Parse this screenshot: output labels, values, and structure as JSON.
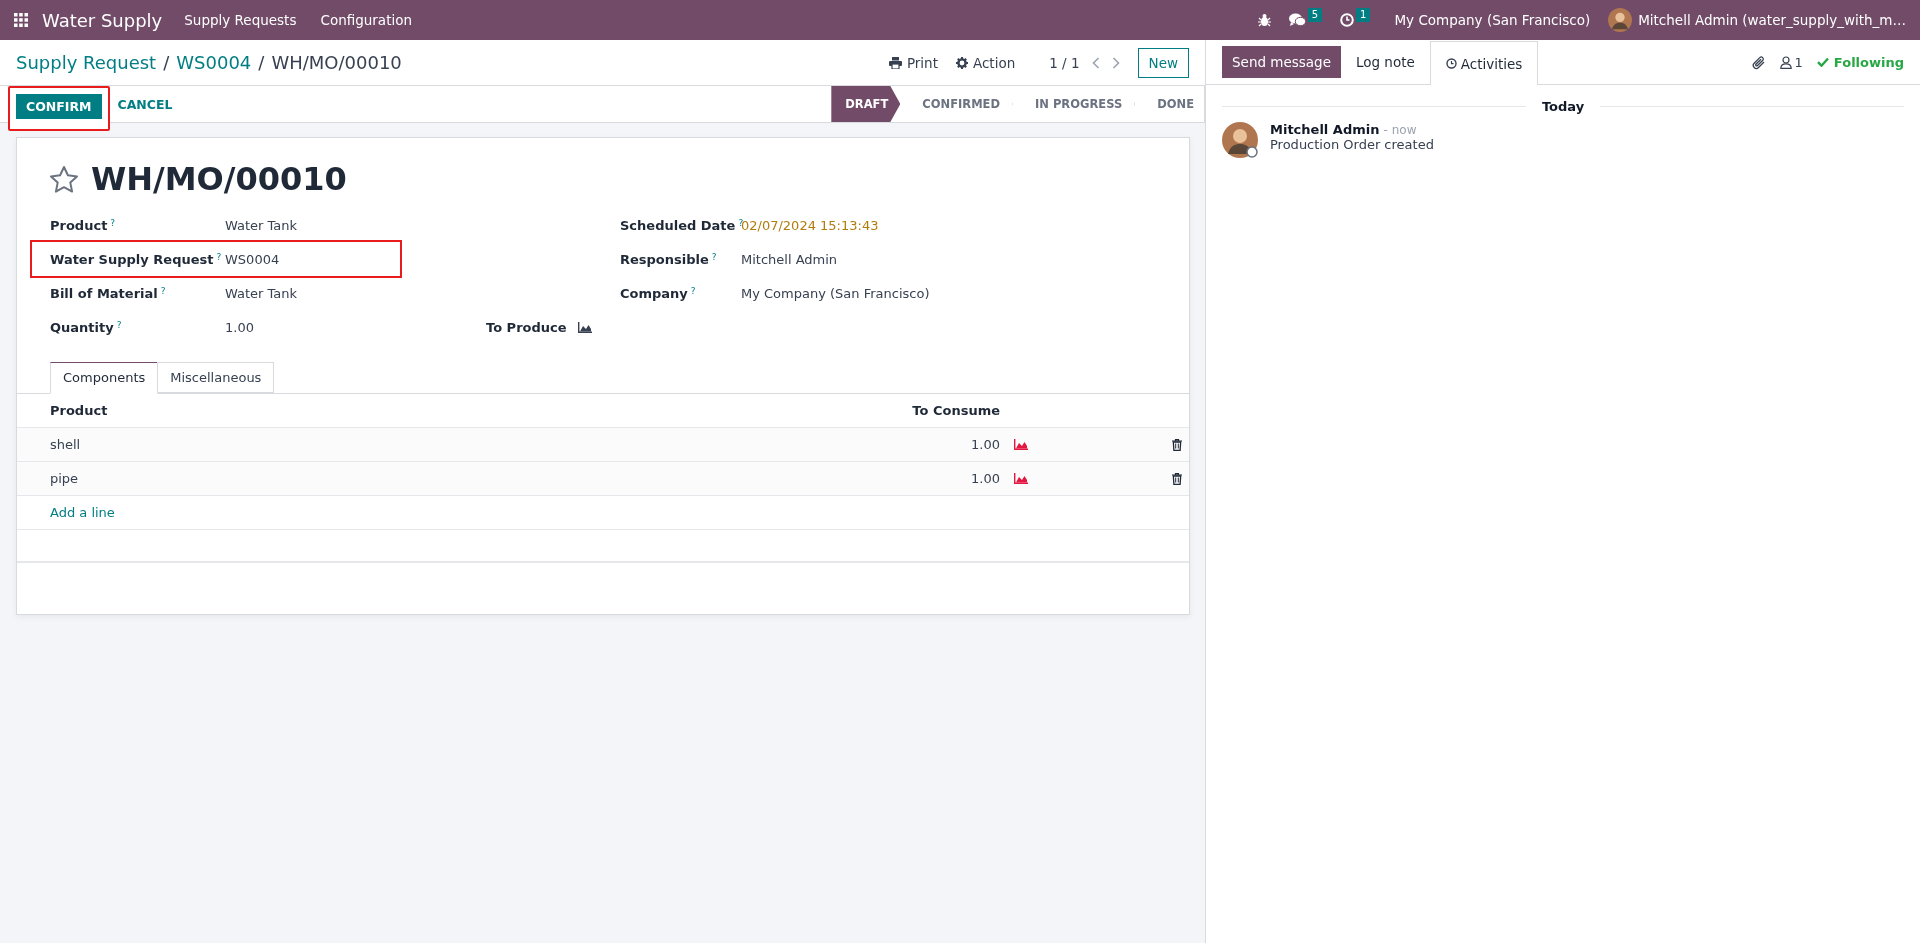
{
  "navbar": {
    "app_name": "Water Supply",
    "menus": [
      "Supply Requests",
      "Configuration"
    ],
    "messages_count": "5",
    "activities_count": "1",
    "company": "My Company (San Francisco)",
    "user": "Mitchell Admin (water_supply_with_m…"
  },
  "breadcrumbs": [
    {
      "label": "Supply Request",
      "kind": "link"
    },
    {
      "separator": "/",
      "label": "WS0004",
      "kind": "link"
    },
    {
      "separator": "/",
      "label": "WH/MO/00010",
      "kind": "current"
    }
  ],
  "toolbar": {
    "print": "Print",
    "action": "Action",
    "pager": "1 / 1",
    "new": "New"
  },
  "actions": [
    {
      "label": "CONFIRM",
      "kind": "primary",
      "highlighted": true
    },
    {
      "label": "CANCEL",
      "kind": "link",
      "highlighted": false
    }
  ],
  "stages": [
    {
      "label": "DRAFT",
      "selected": true
    },
    {
      "label": "CONFIRMED",
      "selected": false
    },
    {
      "label": "IN PROGRESS",
      "selected": false
    },
    {
      "label": "DONE",
      "selected": false
    }
  ],
  "form": {
    "title": "WH/MO/00010",
    "starred": false,
    "left_fields": [
      {
        "label": "Product",
        "help": "?",
        "value": "Water Tank",
        "highlighted": false
      },
      {
        "label": "Water Supply Request",
        "help": "?",
        "value": "WS0004",
        "highlighted": true
      },
      {
        "label": "Bill of Material",
        "help": "?",
        "value": "Water Tank",
        "highlighted": false
      },
      {
        "label": "Quantity",
        "help": "?",
        "value": "1.00",
        "highlighted": false
      }
    ],
    "to_produce": "To Produce",
    "right_fields": [
      {
        "label": "Scheduled Date",
        "help": "?",
        "value": "02/07/2024 15:13:43",
        "kind": "date"
      },
      {
        "label": "Responsible",
        "help": "?",
        "value": "Mitchell Admin",
        "kind": "text"
      },
      {
        "label": "Company",
        "help": "?",
        "value": "My Company (San Francisco)",
        "kind": "text"
      }
    ]
  },
  "tabs": [
    {
      "label": "Components",
      "selected": true
    },
    {
      "label": "Miscellaneous",
      "selected": false
    }
  ],
  "table": {
    "columns": [
      "Product",
      "To Consume"
    ],
    "rows": [
      {
        "product": "shell",
        "to_consume": "1.00"
      },
      {
        "product": "pipe",
        "to_consume": "1.00"
      }
    ],
    "add_line": "Add a line"
  },
  "chatter": {
    "buttons": [
      {
        "label": "Send message",
        "kind": "primary"
      },
      {
        "label": "Log note",
        "kind": "plain"
      },
      {
        "label": "Activities",
        "kind": "tab"
      }
    ],
    "followers_count": "1",
    "following": "Following",
    "date_separator": "Today",
    "messages": [
      {
        "author": "Mitchell Admin",
        "time": "- now",
        "body": "Production Order created"
      }
    ]
  }
}
